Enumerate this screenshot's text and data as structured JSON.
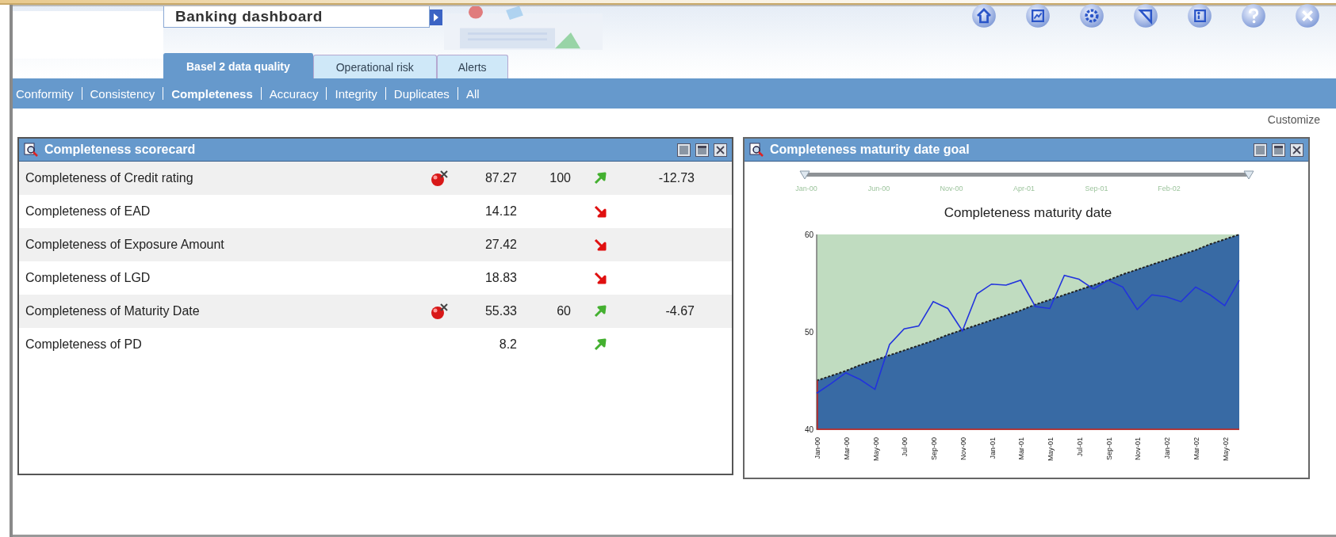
{
  "header": {
    "title": "Banking dashboard",
    "toolbar": [
      {
        "kind": "home"
      },
      {
        "kind": "report"
      },
      {
        "kind": "settings"
      },
      {
        "kind": "triangle"
      },
      {
        "kind": "info"
      },
      {
        "kind": "help"
      },
      {
        "kind": "close"
      }
    ]
  },
  "tabs": [
    {
      "label": "Basel 2 data quality",
      "selected": true
    },
    {
      "label": "Operational risk",
      "selected": false
    },
    {
      "label": "Alerts",
      "selected": false
    }
  ],
  "subnav": [
    {
      "label": "Conformity",
      "selected": false
    },
    {
      "label": "Consistency",
      "selected": false
    },
    {
      "label": "Completeness",
      "selected": true
    },
    {
      "label": "Accuracy",
      "selected": false
    },
    {
      "label": "Integrity",
      "selected": false
    },
    {
      "label": "Duplicates",
      "selected": false
    },
    {
      "label": "All",
      "selected": false
    }
  ],
  "customize_link": "Customize",
  "scorecard": {
    "title": "Completeness scorecard",
    "rows": [
      {
        "name": "Completeness of Credit rating",
        "alert": true,
        "value": "87.27",
        "target": "100",
        "rising": true,
        "variance": "-12.73"
      },
      {
        "name": "Completeness of EAD",
        "alert": false,
        "value": "14.12",
        "rising": false
      },
      {
        "name": "Completeness of Exposure Amount",
        "alert": false,
        "value": "27.42",
        "rising": false
      },
      {
        "name": "Completeness of LGD",
        "alert": false,
        "value": "18.83",
        "rising": false
      },
      {
        "name": "Completeness of Maturity Date",
        "alert": true,
        "value": "55.33",
        "target": "60",
        "rising": true,
        "variance": "-4.67"
      },
      {
        "name": "Completeness of PD",
        "alert": false,
        "value": "8.2",
        "rising": true
      }
    ]
  },
  "goal_panel": {
    "title": "Completeness maturity date goal",
    "range_slider": {
      "labels": [
        "Jan-00",
        "Jun-00",
        "Nov-00",
        "Apr-01",
        "Sep-01",
        "Feb-02"
      ]
    },
    "chart_data": {
      "type": "area",
      "title": "Completeness maturity date",
      "categories": [
        "Jan-00",
        null,
        "Mar-00",
        null,
        "May-00",
        null,
        "Jul-00",
        null,
        "Sep-00",
        null,
        "Nov-00",
        null,
        "Jan-01",
        null,
        "Mar-01",
        null,
        "May-01",
        null,
        "Jul-01",
        null,
        "Sep-01",
        null,
        "Nov-01",
        null,
        "Jan-02",
        null,
        "Mar-02",
        null,
        "May-02",
        null
      ],
      "ylim": [
        40,
        60
      ],
      "yticks": [
        40,
        50,
        60
      ],
      "series": [
        {
          "type": "line",
          "color": "#2233dd",
          "values": [
            43.7,
            44.7,
            45.8,
            45.1,
            44.1,
            48.7,
            50.3,
            50.6,
            53.1,
            52.4,
            50.1,
            53.9,
            54.9,
            54.8,
            55.3,
            52.6,
            52.4,
            55.8,
            55.4,
            54.4,
            55.3,
            54.6,
            52.3,
            53.8,
            53.6,
            53.1,
            54.6,
            53.8,
            52.7,
            55.3
          ]
        },
        {
          "color": "#386aa4",
          "line_style": "dashed",
          "values": [
            45,
            45.5,
            46,
            46.6,
            47.1,
            47.6,
            48.1,
            48.6,
            49.1,
            49.7,
            50.2,
            50.7,
            51.2,
            51.7,
            52.2,
            52.8,
            53.3,
            53.8,
            54.3,
            54.8,
            55.3,
            55.9,
            56.4,
            56.9,
            57.4,
            57.9,
            58.4,
            59,
            59.5,
            60
          ]
        }
      ]
    }
  }
}
